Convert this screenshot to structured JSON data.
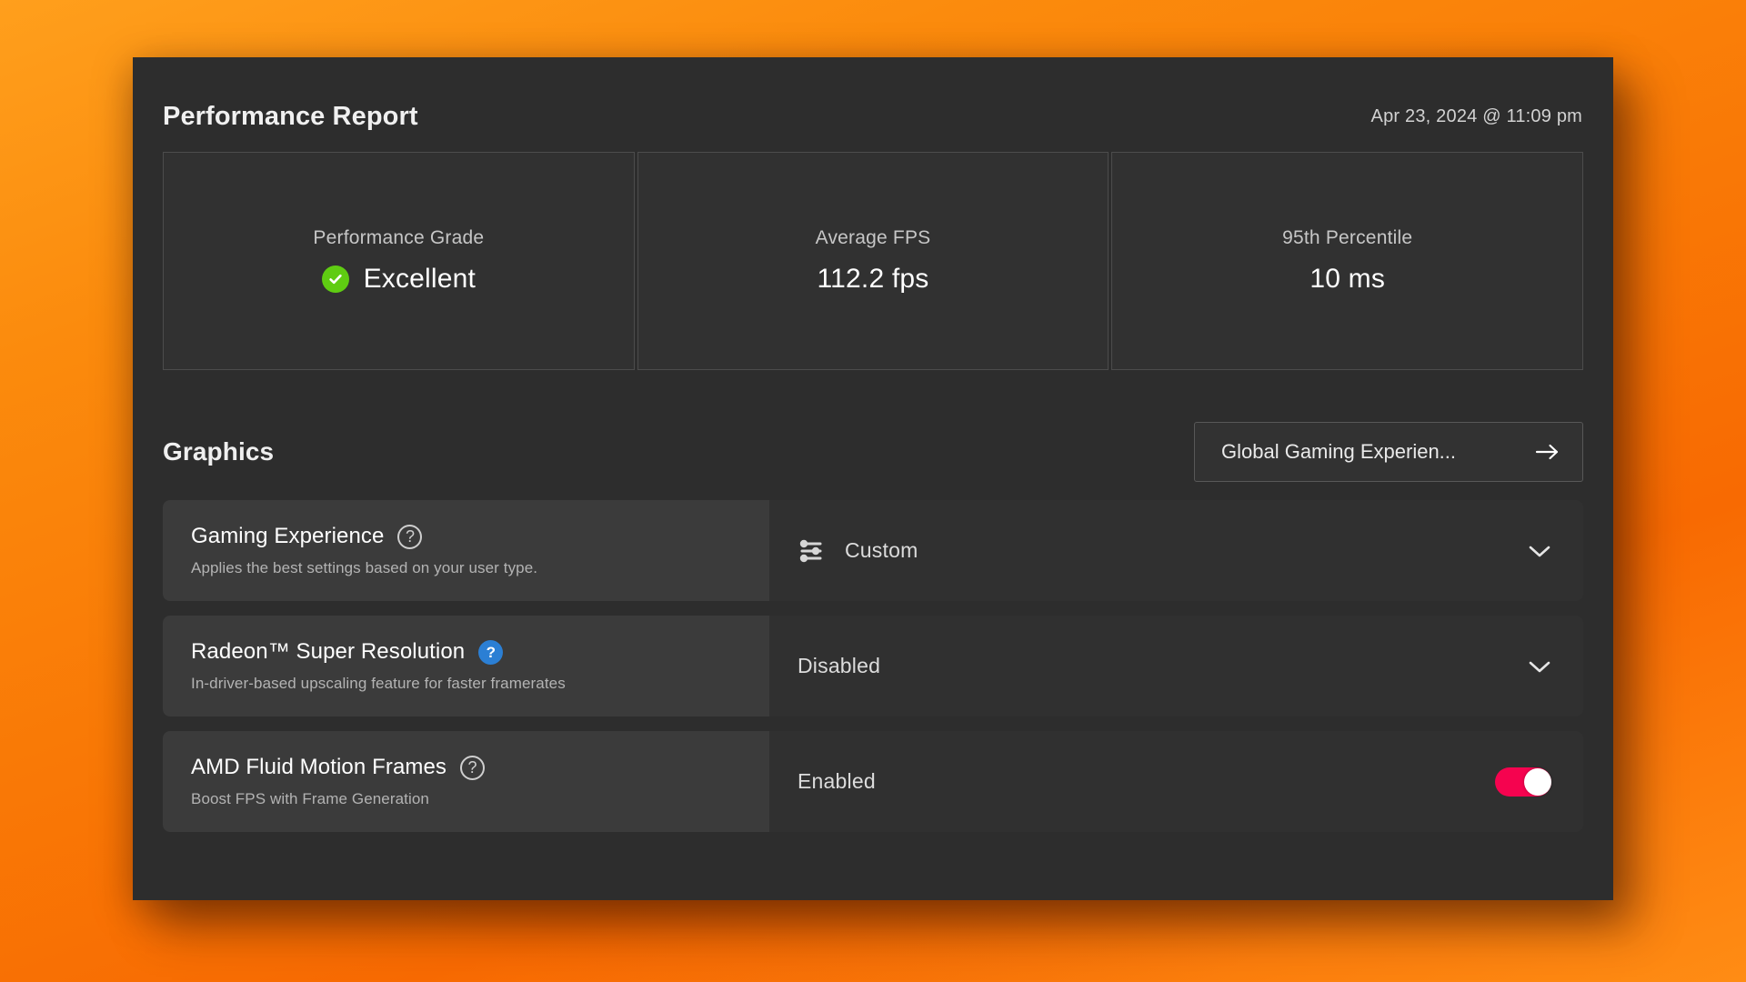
{
  "header": {
    "title": "Performance Report",
    "timestamp": "Apr 23, 2024 @ 11:09 pm"
  },
  "stats": [
    {
      "label": "Performance Grade",
      "value": "Excellent",
      "badge_icon": "check-circle-icon",
      "badge_color": "#5fcc12"
    },
    {
      "label": "Average FPS",
      "value": "112.2 fps"
    },
    {
      "label": "95th Percentile",
      "value": "10 ms"
    }
  ],
  "graphics": {
    "section_title": "Graphics",
    "global_button": {
      "label": "Global Gaming Experien...",
      "icon": "arrow-right-icon"
    },
    "settings": [
      {
        "title": "Gaming Experience",
        "description": "Applies the best settings based on your user type.",
        "help_icon": "help-circle-outline-icon",
        "help_style": "outline",
        "value": "Custom",
        "value_icon": "sliders-icon",
        "control": "dropdown",
        "control_icon": "chevron-down-icon"
      },
      {
        "title": "Radeon™ Super Resolution",
        "description": "In-driver-based upscaling feature for faster framerates",
        "help_icon": "help-circle-filled-icon",
        "help_style": "filled",
        "help_color": "#2b7fd4",
        "value": "Disabled",
        "control": "dropdown",
        "control_icon": "chevron-down-icon"
      },
      {
        "title": "AMD Fluid Motion Frames",
        "description": "Boost FPS with Frame Generation",
        "help_icon": "help-circle-outline-icon",
        "help_style": "outline",
        "value": "Enabled",
        "control": "toggle",
        "toggle_state": "on",
        "toggle_color": "#f5034f"
      }
    ]
  },
  "help_glyph": "?"
}
